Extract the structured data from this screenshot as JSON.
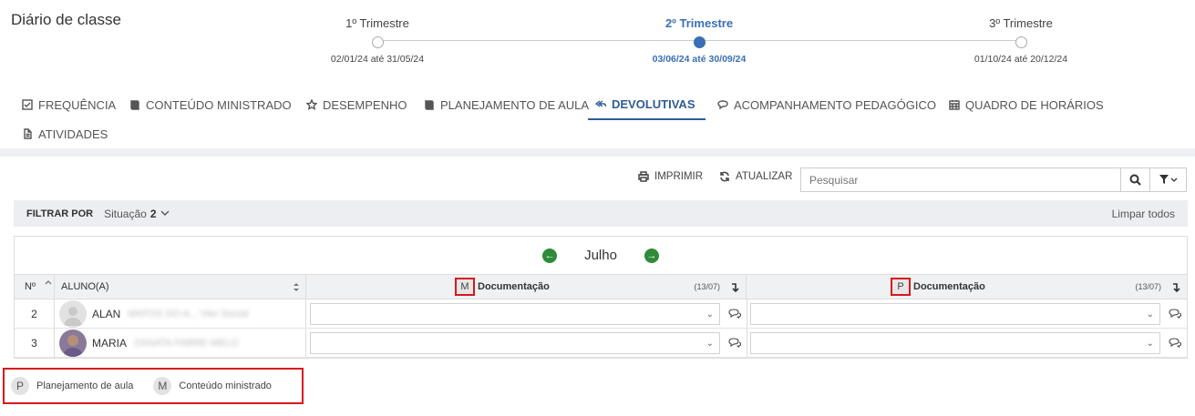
{
  "page_title": "Diário de classe",
  "trimesters": [
    {
      "name": "1º Trimestre",
      "dates": "02/01/24 até 31/05/24",
      "active": false
    },
    {
      "name": "2º Trimestre",
      "dates": "03/06/24 até 30/09/24",
      "active": true
    },
    {
      "name": "3º Trimestre",
      "dates": "01/10/24 até 20/12/24",
      "active": false
    }
  ],
  "tabs": [
    {
      "label": "FREQUÊNCIA",
      "icon": "check-square-icon"
    },
    {
      "label": "CONTEÚDO MINISTRADO",
      "icon": "book-icon"
    },
    {
      "label": "DESEMPENHO",
      "icon": "star-icon"
    },
    {
      "label": "PLANEJAMENTO DE AULA",
      "icon": "book-icon"
    },
    {
      "label": "DEVOLUTIVAS",
      "icon": "reply-all-icon",
      "active": true
    },
    {
      "label": "ACOMPANHAMENTO PEDAGÓGICO",
      "icon": "chat-icon"
    },
    {
      "label": "QUADRO DE HORÁRIOS",
      "icon": "calendar-icon"
    },
    {
      "label": "ATIVIDADES",
      "icon": "file-icon"
    }
  ],
  "toolbar": {
    "print_label": "IMPRIMIR",
    "refresh_label": "ATUALIZAR",
    "search_placeholder": "Pesquisar"
  },
  "filter": {
    "label": "FILTRAR POR",
    "situation_label": "Situação",
    "situation_count": "2",
    "clear_label": "Limpar todos"
  },
  "grid": {
    "month": "Julho",
    "col_number": "Nº",
    "col_student": "ALUNO(A)",
    "columns": [
      {
        "badge": "M",
        "title": "Documentação",
        "date": "(13/07)"
      },
      {
        "badge": "P",
        "title": "Documentação",
        "date": "(13/07)"
      }
    ],
    "rows": [
      {
        "number": "2",
        "name": "ALAN",
        "name_hidden": "MATOS DO A... Vier Social"
      },
      {
        "number": "3",
        "name": "MARIA",
        "name_hidden": "ZANATA FABRE MELO"
      }
    ]
  },
  "legend": [
    {
      "badge": "P",
      "label": "Planejamento de aula"
    },
    {
      "badge": "M",
      "label": "Conteúdo ministrado"
    }
  ],
  "colors": {
    "accent": "#3a6fb5",
    "highlight": "#d9161f",
    "nav_green": "#2e8b3a"
  }
}
